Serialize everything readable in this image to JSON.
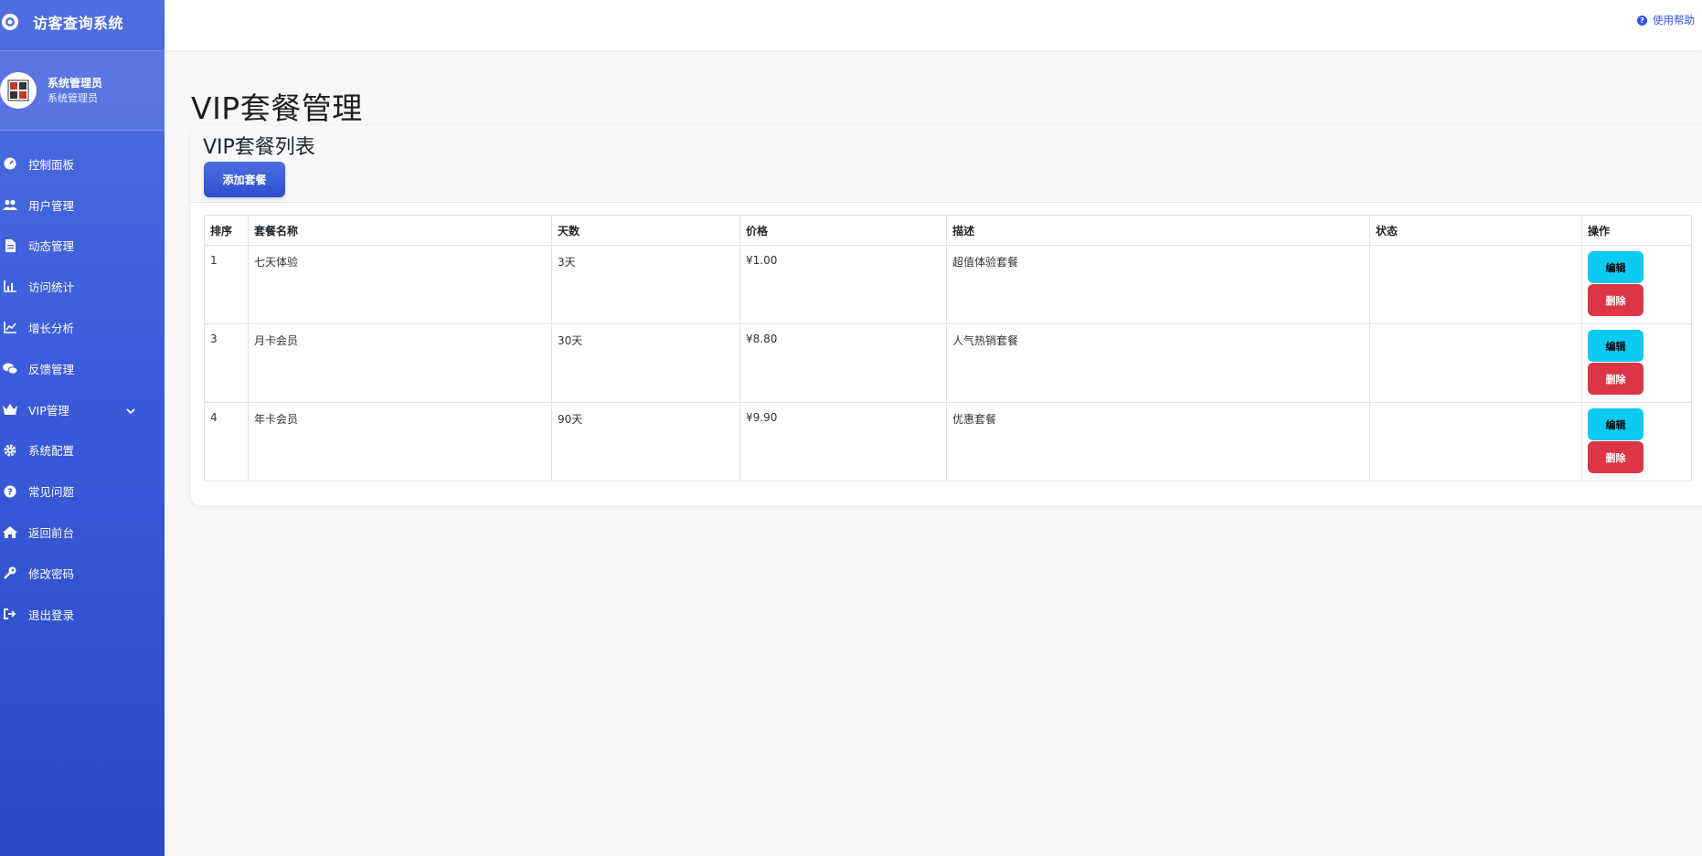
{
  "app": {
    "title": "访客查询系统",
    "logo_icon": "eye-icon"
  },
  "user": {
    "name": "系统管理员",
    "role": "系统管理员"
  },
  "sidebar": {
    "items": [
      {
        "label": "控制面板",
        "icon": "dashboard-icon"
      },
      {
        "label": "用户管理",
        "icon": "users-icon"
      },
      {
        "label": "动态管理",
        "icon": "file-icon"
      },
      {
        "label": "访问统计",
        "icon": "bar-chart-icon"
      },
      {
        "label": "增长分析",
        "icon": "line-chart-icon"
      },
      {
        "label": "反馈管理",
        "icon": "comments-icon"
      },
      {
        "label": "VIP管理",
        "icon": "crown-icon",
        "expandable": true
      },
      {
        "label": "系统配置",
        "icon": "gear-icon"
      },
      {
        "label": "常见问题",
        "icon": "question-icon"
      },
      {
        "label": "返回前台",
        "icon": "home-icon"
      },
      {
        "label": "修改密码",
        "icon": "key-icon"
      },
      {
        "label": "退出登录",
        "icon": "logout-icon"
      }
    ]
  },
  "topbar": {
    "help_label": "使用帮助"
  },
  "page": {
    "title": "VIP套餐管理",
    "card_title": "VIP套餐列表",
    "add_button": "添加套餐"
  },
  "table": {
    "headers": [
      "排序",
      "套餐名称",
      "天数",
      "价格",
      "描述",
      "状态",
      "操作"
    ],
    "rows": [
      {
        "sort": "1",
        "name": "七天体验",
        "days": "3天",
        "price": "¥1.00",
        "desc": "超值体验套餐",
        "status": ""
      },
      {
        "sort": "3",
        "name": "月卡会员",
        "days": "30天",
        "price": "¥8.80",
        "desc": "人气热销套餐",
        "status": ""
      },
      {
        "sort": "4",
        "name": "年卡会员",
        "days": "90天",
        "price": "¥9.90",
        "desc": "优惠套餐",
        "status": ""
      }
    ],
    "edit_label": "编辑",
    "delete_label": "删除"
  },
  "colors": {
    "sidebar_top": "#4f6fe0",
    "sidebar_bottom": "#2a4bc5",
    "primary": "#3b5bdb",
    "edit": "#0dcaf0",
    "delete": "#dc3545",
    "help_link": "#2f54eb"
  }
}
